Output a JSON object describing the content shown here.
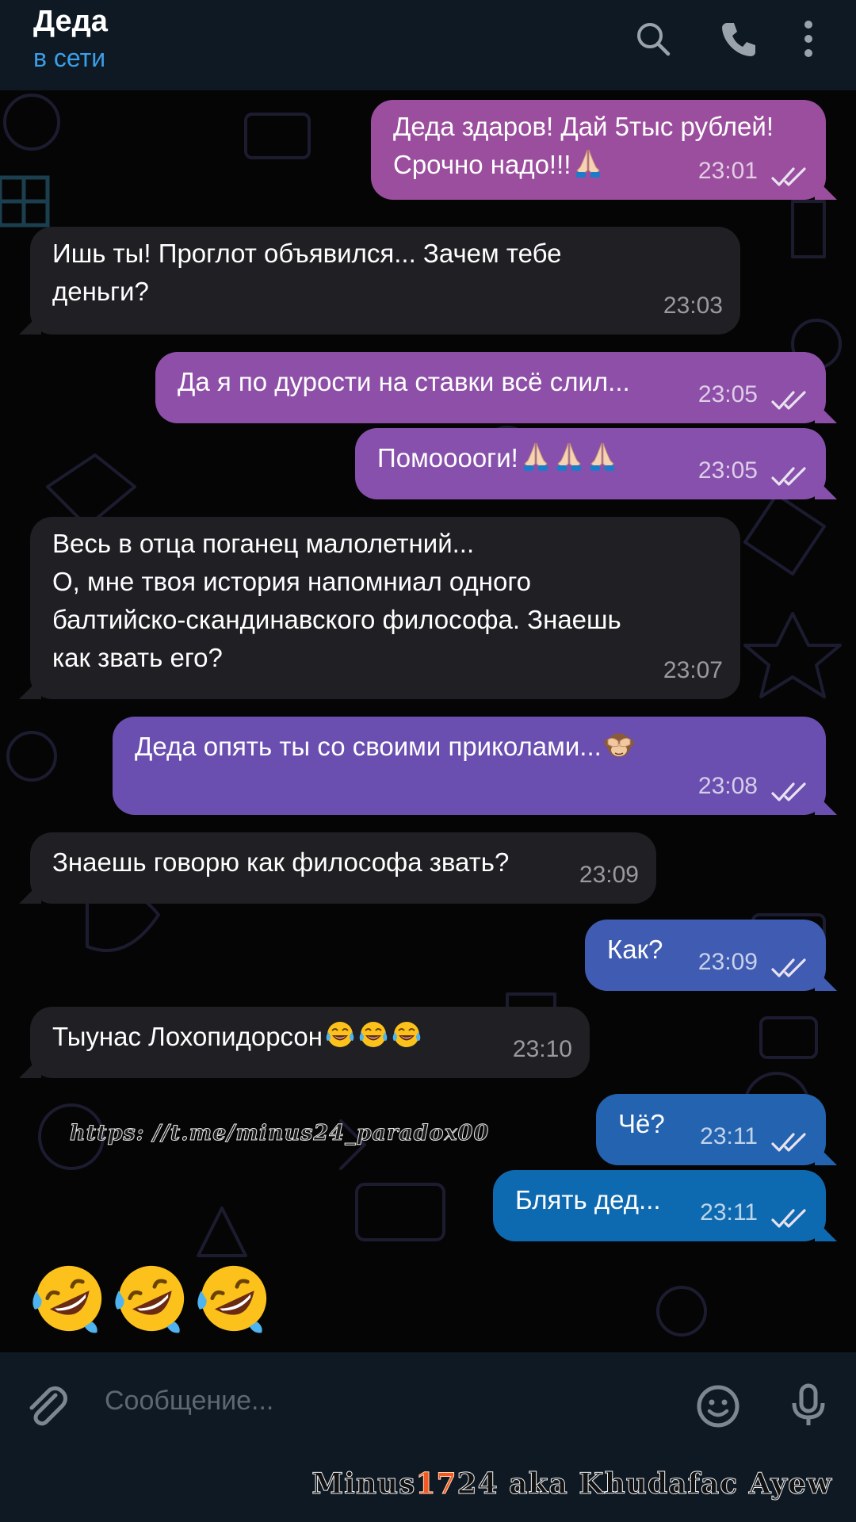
{
  "header": {
    "contact_name": "Деда",
    "status": "в сети",
    "icons": [
      "search-icon",
      "phone-icon",
      "more-vert-icon"
    ]
  },
  "messages": [
    {
      "side": "out",
      "text": "Деда здаров! Дай 5тыс рублей!\nСрочно надо!!!",
      "emoji": [
        "folded-hands"
      ],
      "time": "23:01",
      "read": true,
      "color": "#9b4e9e"
    },
    {
      "side": "in",
      "text": "Ишь ты! Проглот объявился...  Зачем тебе\nденьги?",
      "time": "23:03"
    },
    {
      "side": "out",
      "text": "Да я по дурости на ставки всё слил...",
      "time": "23:05",
      "read": true,
      "color": "#8e4fa8"
    },
    {
      "side": "out",
      "text": "Помооооги!",
      "emoji": [
        "folded-hands",
        "folded-hands",
        "folded-hands"
      ],
      "time": "23:05",
      "read": true,
      "color": "#8750ad"
    },
    {
      "side": "in",
      "text": "Весь в отца поганец малолетний...\nО, мне твоя история напомниал одного\nбалтийско-скандинавского философа. Знаешь\nкак звать его?",
      "time": "23:07"
    },
    {
      "side": "out",
      "text": "Деда опять ты со своими приколами...",
      "emoji": [
        "see-no-evil-monkey"
      ],
      "time": "23:08",
      "read": true,
      "color": "#6a4fb0"
    },
    {
      "side": "in",
      "text": "Знаешь говорю как философа звать?",
      "time": "23:09"
    },
    {
      "side": "out",
      "text": "Как?",
      "time": "23:09",
      "read": true,
      "color": "#3f5cb2"
    },
    {
      "side": "in",
      "text": "Тыунас Лохопидорсон",
      "emoji": [
        "tears-of-joy",
        "tears-of-joy",
        "tears-of-joy"
      ],
      "time": "23:10"
    },
    {
      "side": "out",
      "text": "Чё?",
      "time": "23:11",
      "read": true,
      "color": "#2363b0"
    },
    {
      "side": "out",
      "text": "Блять дед...",
      "time": "23:11",
      "read": true,
      "color": "#0e6ab0"
    }
  ],
  "big_emoji": [
    "rolling-on-floor-laughing",
    "rolling-on-floor-laughing",
    "rolling-on-floor-laughing"
  ],
  "watermark_link": "https: //t.me/minus24_paradox00",
  "input": {
    "placeholder": "Сообщение...",
    "icons": [
      "attach-icon",
      "emoji-icon",
      "microphone-icon"
    ]
  },
  "signature": {
    "before": "Minus",
    "accent": "17",
    "after": "24 aka Khudafac Ayew"
  },
  "colors": {
    "header_bg": "#0f1923",
    "status": "#3a9ee8",
    "incoming_bubble": "#1f1f24",
    "chat_bg": "#050505"
  }
}
